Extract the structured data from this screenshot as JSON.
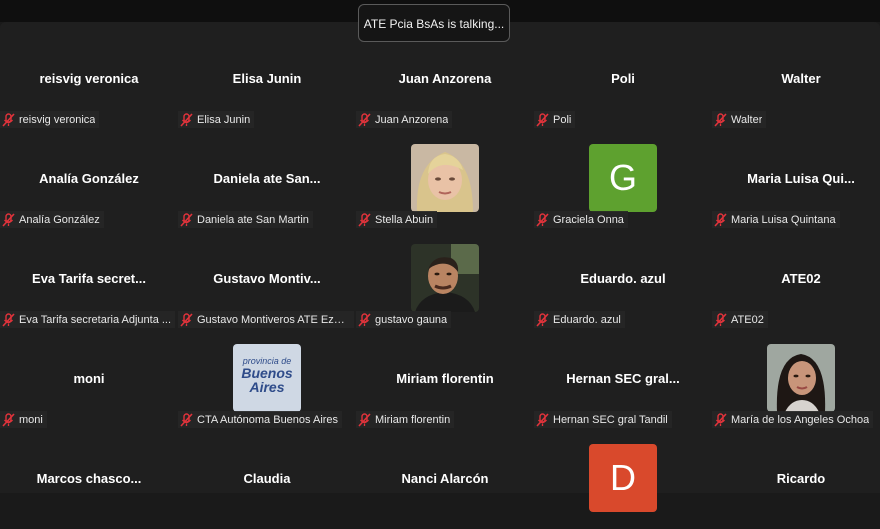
{
  "colors": {
    "avatar_g": "#5ea12f",
    "avatar_d": "#d9492c",
    "muted_mic": "#e0333b"
  },
  "banner": {
    "text": "ATE Pcia BsAs is talking..."
  },
  "rows": [
    [
      {
        "display": "reisvig veronica",
        "tag": "reisvig veronica"
      },
      {
        "display": "Elisa Junin",
        "tag": "Elisa Junin"
      },
      {
        "display": "Juan Anzorena",
        "tag": "Juan Anzorena"
      },
      {
        "display": "Poli",
        "tag": "Poli"
      },
      {
        "display": "Walter",
        "tag": "Walter"
      }
    ],
    [
      {
        "display": "Analía González",
        "tag": "Analía González"
      },
      {
        "display": "Daniela ate San...",
        "tag": "Daniela ate San Martin"
      },
      {
        "avatar": "photo-woman-blonde",
        "tag": "Stella Abuin"
      },
      {
        "avatar": "letter",
        "letter": "G",
        "tag": "Graciela Onna"
      },
      {
        "display": "Maria Luisa Qui...",
        "tag": "Maria Luisa Quintana"
      }
    ],
    [
      {
        "display": "Eva Tarifa secret...",
        "tag": "Eva Tarifa secretaria Adjunta ..."
      },
      {
        "display": "Gustavo  Montiv...",
        "tag": "Gustavo Montiveros ATE Ezei..."
      },
      {
        "avatar": "photo-man",
        "tag": "gustavo gauna"
      },
      {
        "display": "Eduardo. azul",
        "tag": "Eduardo. azul"
      },
      {
        "display": "ATE02",
        "tag": "ATE02"
      }
    ],
    [
      {
        "display": "moni",
        "tag": "moni"
      },
      {
        "avatar": "logo-provincia",
        "tag": "CTA Autónoma Buenos Aires",
        "logo": {
          "line1": "provincia de",
          "line2": "Buenos",
          "line3": "Aires"
        }
      },
      {
        "display": "Miriam florentin",
        "tag": "Miriam florentin"
      },
      {
        "display": "Hernan  SEC gral...",
        "tag": "Hernan SEC gral Tandil"
      },
      {
        "avatar": "photo-woman-dark",
        "tag": "María de los Angeles Ochoa"
      }
    ],
    [
      {
        "display": "Marcos  chasco..."
      },
      {
        "display": "Claudia"
      },
      {
        "display": "Nanci Alarcón"
      },
      {
        "avatar": "letter",
        "letter": "D"
      },
      {
        "display": "Ricardo"
      }
    ]
  ]
}
